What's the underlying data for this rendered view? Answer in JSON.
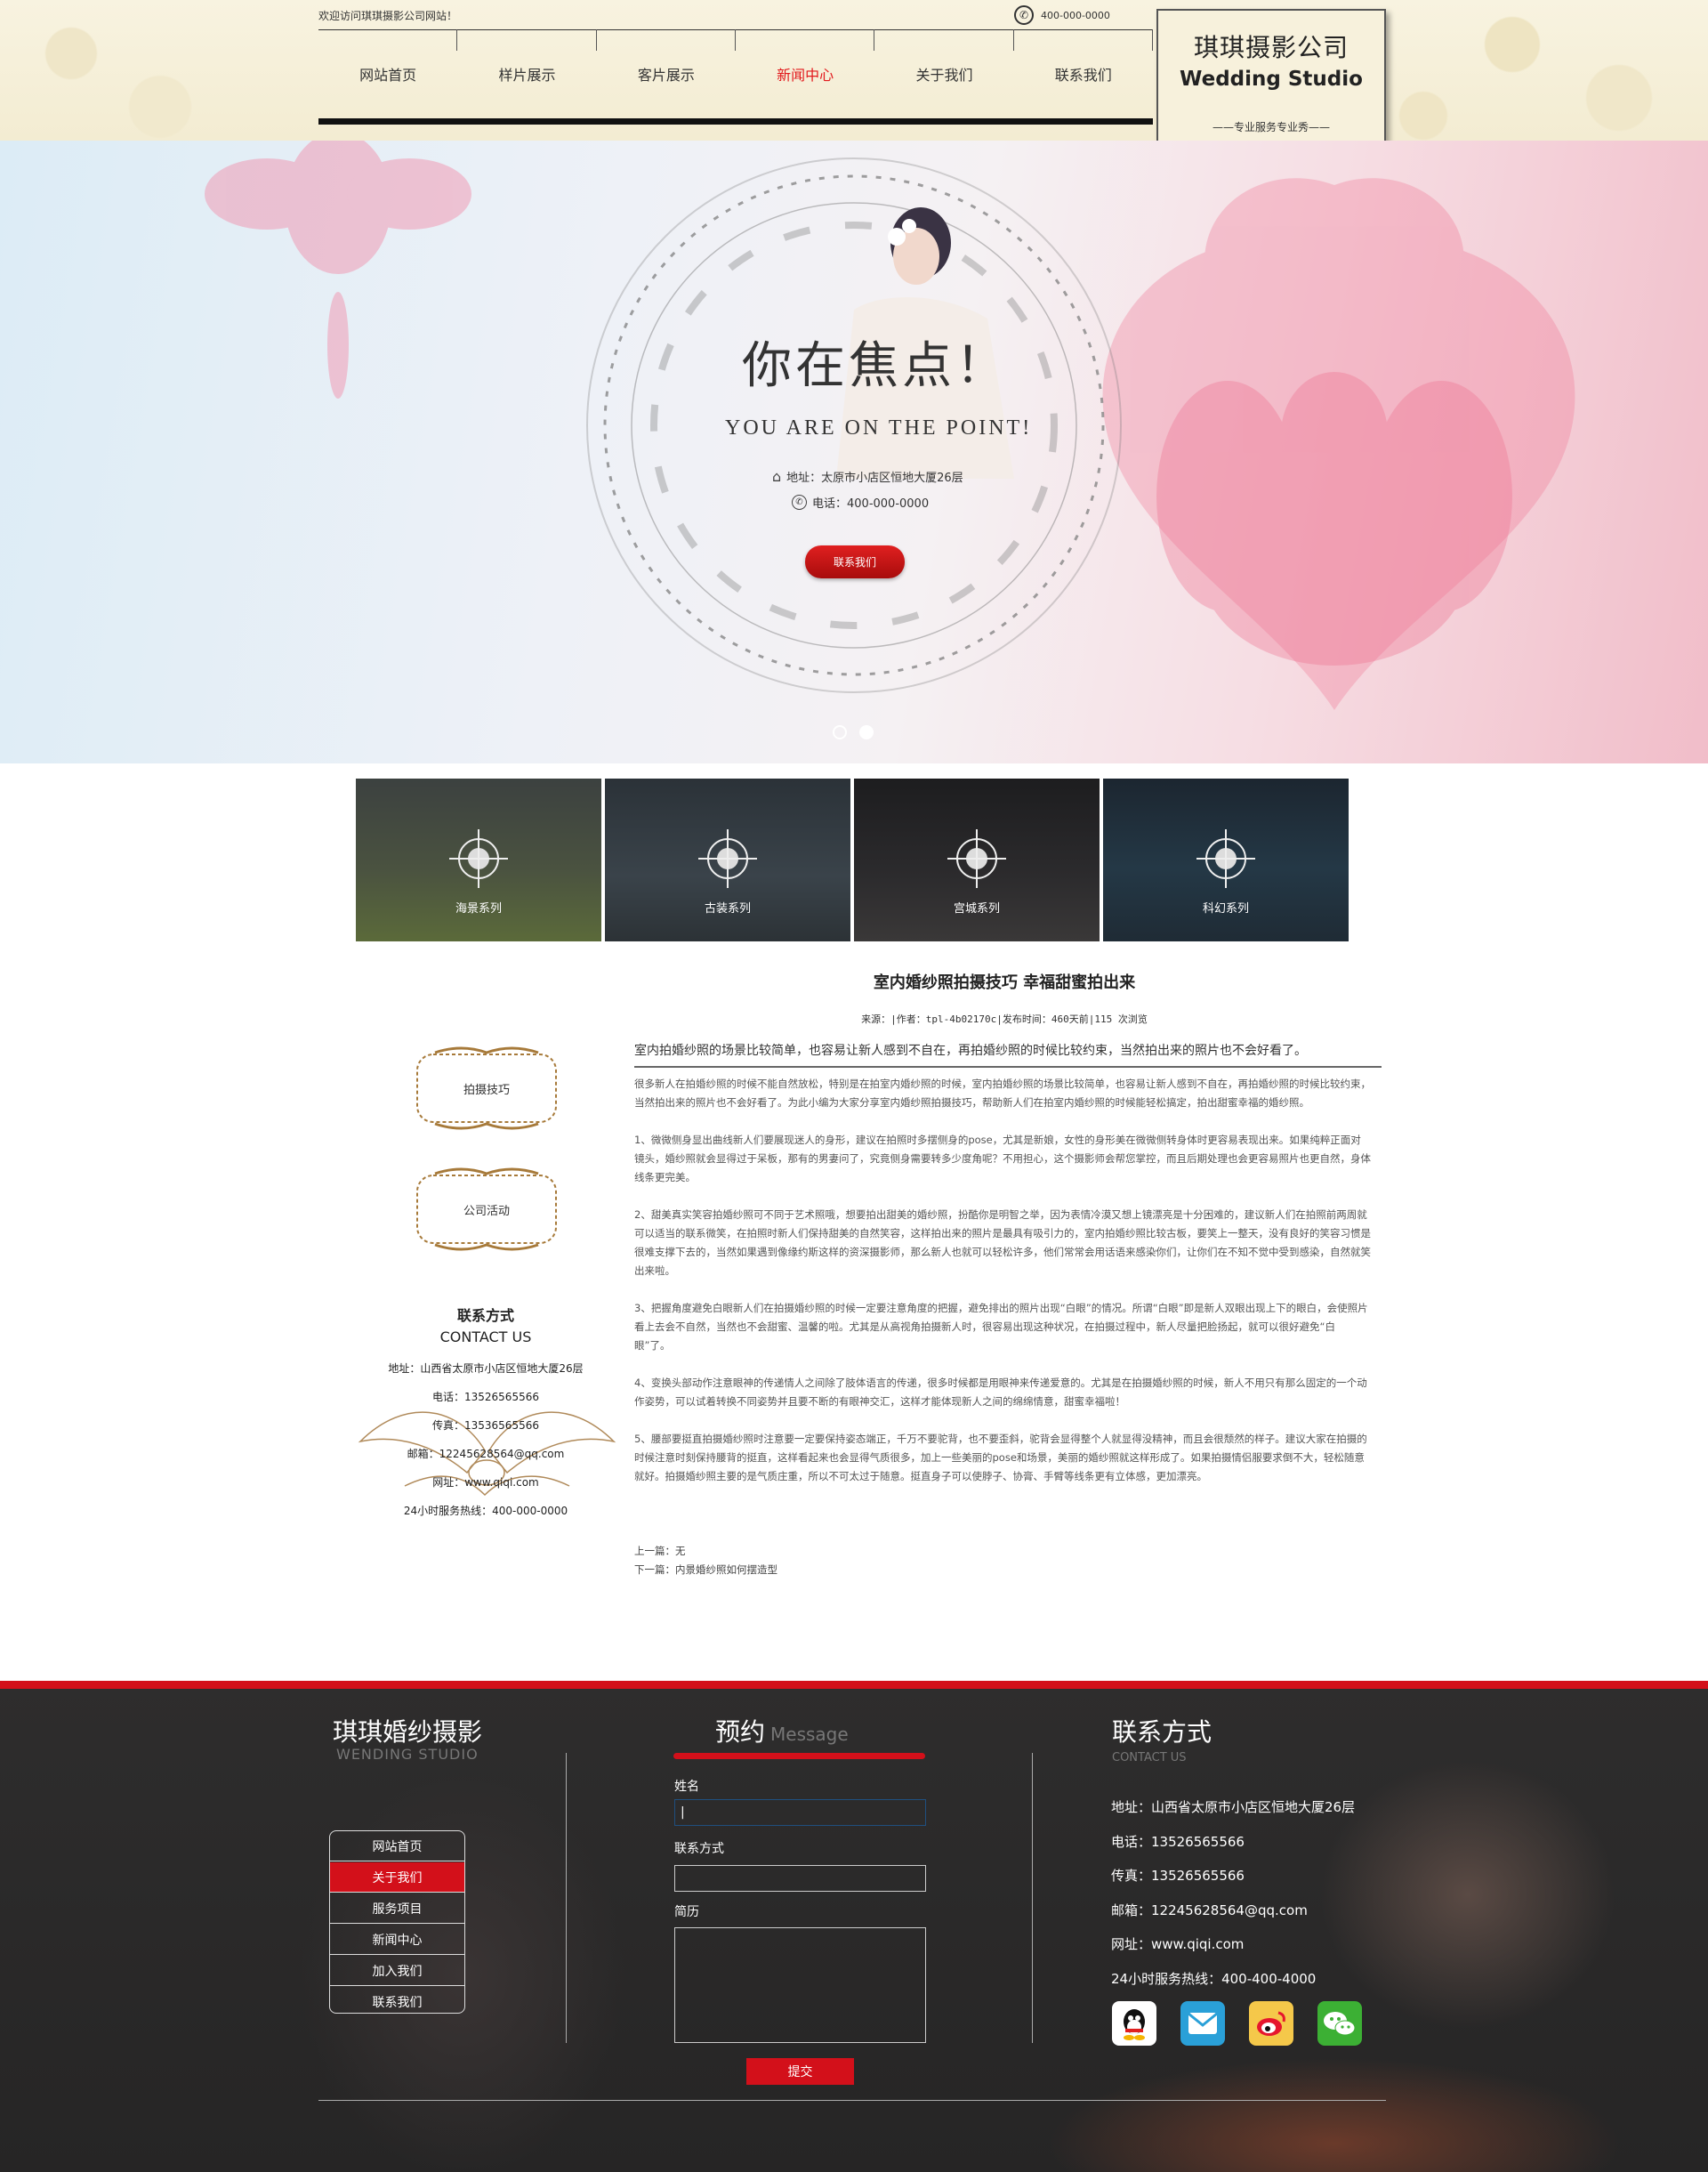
{
  "header": {
    "welcome": "欢迎访问琪琪摄影公司网站！",
    "phone": "400-000-0000",
    "nav": [
      {
        "label": "网站首页",
        "active": false
      },
      {
        "label": "样片展示",
        "active": false
      },
      {
        "label": "客片展示",
        "active": false
      },
      {
        "label": "新闻中心",
        "active": true
      },
      {
        "label": "关于我们",
        "active": false
      },
      {
        "label": "联系我们",
        "active": false
      }
    ],
    "logo": {
      "cn": "琪琪摄影公司",
      "en": "Wedding Studio",
      "slogan": "——专业服务专业秀——"
    }
  },
  "banner": {
    "title": "你在焦点！",
    "subtitle": "YOU ARE ON THE POINT!",
    "address": "地址：太原市小店区恒地大厦26层",
    "phone": "电话：400-000-0000",
    "button": "联系我们",
    "slides": 2,
    "active_slide": 2
  },
  "categories": [
    {
      "label": "海景系列",
      "icon": "crosshair-icon",
      "color": "#46503a"
    },
    {
      "label": "古装系列",
      "icon": "crosshair-icon",
      "color": "#323a40"
    },
    {
      "label": "宫城系列",
      "icon": "crosshair-icon",
      "color": "#28282a"
    },
    {
      "label": "科幻系列",
      "icon": "crosshair-icon",
      "color": "#22303a"
    }
  ],
  "sidebar": {
    "buttons": [
      "拍摄技巧",
      "公司活动"
    ],
    "contact": {
      "title": "联系方式",
      "title_en": "CONTACT US",
      "lines": [
        "地址：山西省太原市小店区恒地大厦26层",
        "电话：13526565566",
        "传真：13536565566",
        "邮箱：12245628564@qq.com",
        "网址：www.qiqi.com",
        "24小时服务热线：400-000-0000"
      ]
    }
  },
  "article": {
    "title": "室内婚纱照拍摄技巧 幸福甜蜜拍出来",
    "meta": "来源：|作者：tpl-4b02170c|发布时间：460天前|115 次浏览",
    "lead": "室内拍婚纱照的场景比较简单，也容易让新人感到不自在，再拍婚纱照的时候比较约束，当然拍出来的照片也不会好看了。",
    "paragraphs": [
      "很多新人在拍婚纱照的时候不能自然放松，特别是在拍室内婚纱照的时候，室内拍婚纱照的场景比较简单，也容易让新人感到不自在，再拍婚纱照的时候比较约束，当然拍出来的照片也不会好看了。为此小编为大家分享室内婚纱照拍摄技巧，帮助新人们在拍室内婚纱照的时候能轻松搞定，拍出甜蜜幸福的婚纱照。",
      "1、微微侧身显出曲线新人们要展现迷人的身形，建议在拍照时多摆侧身的pose，尤其是新娘，女性的身形美在微微侧转身体时更容易表现出来。如果纯粹正面对镜头，婚纱照就会显得过于呆板，那有的男妻问了，究竟侧身需要转多少度角呢？不用担心，这个摄影师会帮您掌控，而且后期处理也会更容易照片也更自然，身体线条更完美。",
      "2、甜美真实笑容拍婚纱照可不同于艺术照哦，想要拍出甜美的婚纱照，扮酷你是明智之举，因为表情冷漠又想上镜漂亮是十分困难的，建议新人们在拍照前两周就可以适当的联系微笑，在拍照时新人们保持甜美的自然笑容，这样拍出来的照片是最具有吸引力的，室内拍婚纱照比较古板，要笑上一整天，没有良好的笑容习惯是很难支撑下去的，当然如果遇到像缘约斯这样的资深摄影师，那么新人也就可以轻松许多，他们常常会用话语来感染你们，让你们在不知不觉中受到感染，自然就笑出来啦。",
      "3、把握角度避免白眼新人们在拍摄婚纱照的时候一定要注意角度的把握，避免排出的照片出现“白眼”的情况。所谓“白眼”即是新人双眼出现上下的眼白，会使照片看上去会不自然，当然也不会甜蜜、温馨的啦。尤其是从高视角拍摄新人时，很容易出现这种状况，在拍摄过程中，新人尽量把脸扬起，就可以很好避免“白眼”了。",
      "4、变换头部动作注意眼神的传递情人之间除了肢体语言的传递，很多时候都是用眼神来传递爱意的。尤其是在拍摄婚纱照的时候，新人不用只有那么固定的一个动作姿势，可以试着转换不同姿势并且要不断的有眼神交汇，这样才能体现新人之间的绵绵情意，甜蜜幸福啦！",
      "5、腰部要挺直拍摄婚纱照时注意要一定要保持姿态端正，千万不要驼背，也不要歪斜，驼背会显得整个人就显得没精神，而且会很颓然的样子。建议大家在拍摄的时候注意时刻保持腰背的挺直，这样看起来也会显得气质很多，加上一些美丽的pose和场景，美丽的婚纱照就这样形成了。如果拍摄情侣服要求倒不大，轻松随意就好。拍摄婚纱照主要的是气质庄重，所以不可太过于随意。挺直身子可以使脖子、协膏、手臂等线条更有立体感，更加漂亮。"
    ],
    "prev": "上一篇：无",
    "next": "下一篇：内景婚纱照如何摆造型"
  },
  "footer": {
    "brand": "琪琪婚纱摄影",
    "brand_en": "WENDING STUDIO",
    "menu": [
      {
        "label": "网站首页",
        "active": false
      },
      {
        "label": "关于我们",
        "active": true
      },
      {
        "label": "服务项目",
        "active": false
      },
      {
        "label": "新闻中心",
        "active": false
      },
      {
        "label": "加入我们",
        "active": false
      },
      {
        "label": "联系我们",
        "active": false
      }
    ],
    "message": {
      "title": "预约",
      "title_en": "Message",
      "name_label": "姓名",
      "name_value": "|",
      "contact_label": "联系方式",
      "contact_value": "",
      "resume_label": "简历",
      "submit": "提交"
    },
    "contact": {
      "title": "联系方式",
      "title_en": "CONTACT US",
      "lines": [
        "地址：山西省太原市小店区恒地大厦26层",
        "电话：13526565566",
        "传真：13526565566",
        "邮箱：12245628564@qq.com",
        "网址：www.qiqi.com",
        "24小时服务热线：400-400-4000"
      ]
    },
    "social": [
      {
        "name": "qq-icon",
        "color": "#ffffff"
      },
      {
        "name": "email-icon",
        "color": "#2aa0d8"
      },
      {
        "name": "weibo-icon",
        "color": "#f5c84a"
      },
      {
        "name": "wechat-icon",
        "color": "#3cb034"
      }
    ]
  },
  "colors": {
    "accent": "#d3101a",
    "nav_active": "#e2191c"
  }
}
